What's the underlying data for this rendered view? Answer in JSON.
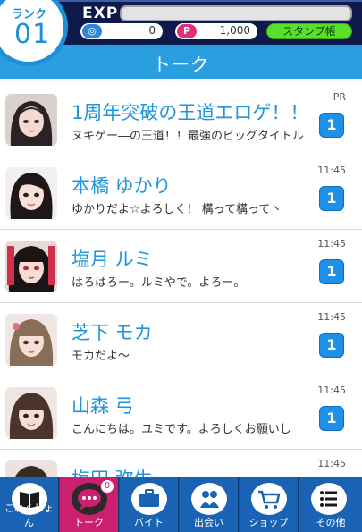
{
  "header": {
    "rank_label": "ランク",
    "rank_value": "01",
    "exp_label": "EXP",
    "exp_progress": 0,
    "coins": "0",
    "points": "1,000",
    "stamp_button": "スタンプ帳",
    "title": "トーク"
  },
  "chats": [
    {
      "name": "1周年突破の王道エロゲ！！",
      "preview": "ヌキゲー―の王道！！最強のビッグタイトル",
      "time": "PR",
      "unread": "1"
    },
    {
      "name": "本橋 ゆかり",
      "preview": "ゆかりだよ☆よろしく！ 構って構って丶",
      "time": "11:45",
      "unread": "1"
    },
    {
      "name": "塩月 ルミ",
      "preview": "はろはろー。ルミやで。よろー。",
      "time": "11:45",
      "unread": "1"
    },
    {
      "name": "芝下 モカ",
      "preview": "モカだよ～",
      "time": "11:45",
      "unread": "1"
    },
    {
      "name": "山森 弓",
      "preview": "こんにちは。ユミです。よろしくお願いし",
      "time": "11:45",
      "unread": "1"
    },
    {
      "name": "梅田 弥生",
      "preview": "",
      "time": "11:45",
      "unread": ""
    }
  ],
  "nav": [
    {
      "label": "これくしょん",
      "icon": "book-icon"
    },
    {
      "label": "トーク",
      "icon": "chat-icon",
      "badge": "0"
    },
    {
      "label": "バイト",
      "icon": "briefcase-icon"
    },
    {
      "label": "出会い",
      "icon": "encounter-icon"
    },
    {
      "label": "ショップ",
      "icon": "cart-icon"
    },
    {
      "label": "その他",
      "icon": "menu-icon"
    }
  ],
  "colors": {
    "accent": "#1f96dc",
    "header_dark": "#0d1a4a",
    "nav_blue": "#1a63b4",
    "nav_active": "#cc1f6f",
    "stamp_green": "#59e02a"
  }
}
